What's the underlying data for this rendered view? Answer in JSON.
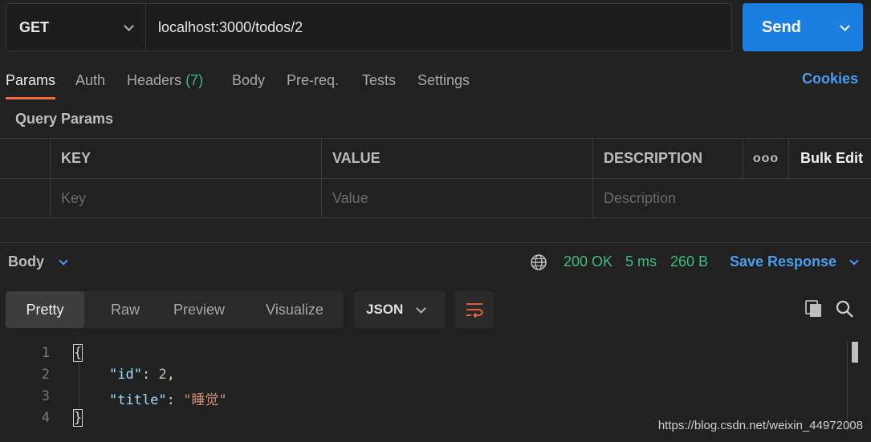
{
  "request": {
    "method": "GET",
    "url": "localhost:3000/todos/2",
    "send_label": "Send"
  },
  "tabs": [
    {
      "label": "Params",
      "active": true
    },
    {
      "label": "Auth"
    },
    {
      "label": "Headers",
      "count": "(7)"
    },
    {
      "label": "Body"
    },
    {
      "label": "Pre-req."
    },
    {
      "label": "Tests"
    },
    {
      "label": "Settings"
    }
  ],
  "cookies_label": "Cookies",
  "query_params": {
    "title": "Query Params",
    "headers": [
      "KEY",
      "VALUE",
      "DESCRIPTION"
    ],
    "more_label": "ooo",
    "bulk_edit_label": "Bulk Edit",
    "placeholders": {
      "key": "Key",
      "value": "Value",
      "description": "Description"
    }
  },
  "response": {
    "body_label": "Body",
    "status": "200 OK",
    "time": "5 ms",
    "size": "260 B",
    "save_label": "Save Response",
    "views": [
      "Pretty",
      "Raw",
      "Preview",
      "Visualize"
    ],
    "format": "JSON",
    "lines": [
      "1",
      "2",
      "3",
      "4"
    ],
    "json": {
      "open": "{",
      "id_key": "\"id\"",
      "id_val": "2",
      "title_key": "\"title\"",
      "title_val": "\"睡觉\"",
      "close": "}"
    }
  },
  "watermark": "https://blog.csdn.net/weixin_44972008",
  "colors": {
    "accent": "#1a7fe0",
    "active_tab": "#f26b3a",
    "status": "#3dbd7d",
    "link": "#4a9df0"
  }
}
